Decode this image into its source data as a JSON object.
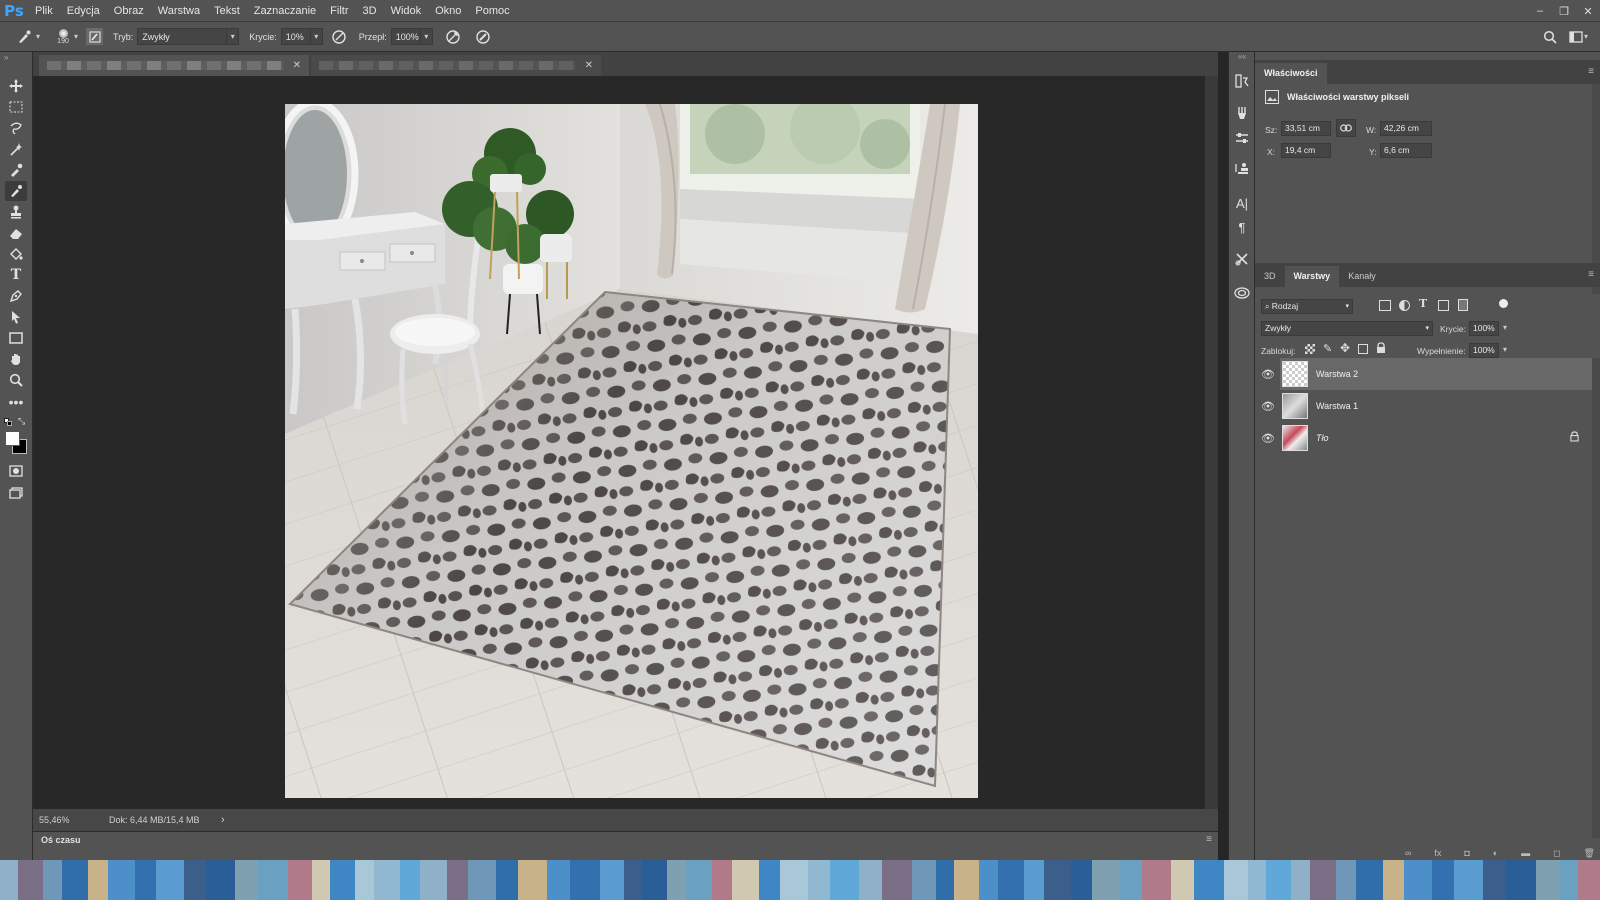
{
  "menubar": {
    "logo": "Ps",
    "items": [
      "Plik",
      "Edycja",
      "Obraz",
      "Warstwa",
      "Tekst",
      "Zaznaczanie",
      "Filtr",
      "3D",
      "Widok",
      "Okno",
      "Pomoc"
    ],
    "window_controls": [
      "–",
      "❐",
      "✕"
    ]
  },
  "options": {
    "brush_size": "190",
    "mode_label": "Tryb:",
    "mode_value": "Zwykły",
    "opacity_label": "Krycie:",
    "opacity_value": "10%",
    "flow_label": "Przepł:",
    "flow_value": "100%"
  },
  "tools": [
    "move-tool",
    "marquee-tool",
    "lasso-tool",
    "magic-wand-tool",
    "eyedropper-tool",
    "brush-tool",
    "stamp-tool",
    "eraser-tool",
    "paint-bucket-tool",
    "text-tool",
    "pen-tool",
    "path-select-tool",
    "rectangle-tool",
    "hand-tool",
    "zoom-tool",
    "more-tools"
  ],
  "status": {
    "zoom": "55,46%",
    "doc": "Dok: 6,44 MB/15,4 MB",
    "arrow": "›"
  },
  "timeline": {
    "label": "Oś czasu"
  },
  "properties": {
    "tab": "Właściwości",
    "heading": "Właściwości warstwy pikseli",
    "w_label": "Sz:",
    "w_value": "33,51 cm",
    "h_label": "W:",
    "h_value": "42,26 cm",
    "x_label": "X:",
    "x_value": "19,4 cm",
    "y_label": "Y:",
    "y_value": "6,6 cm"
  },
  "layers_panel": {
    "tabs": [
      "3D",
      "Warstwy",
      "Kanały"
    ],
    "filter_kind": "Rodzaj",
    "blend_mode": "Zwykły",
    "opacity_label": "Krycie:",
    "opacity_value": "100%",
    "lock_label": "Zablokuj:",
    "fill_label": "Wypełnienie:",
    "fill_value": "100%",
    "layers": [
      {
        "name": "Warstwa 2",
        "selected": true
      },
      {
        "name": "Warstwa 1",
        "selected": false
      },
      {
        "name": "Tło",
        "selected": false,
        "locked": true
      }
    ]
  },
  "colors": {
    "accent": "#3ea6ff",
    "panel": "#535353",
    "canvas": "#282828"
  }
}
